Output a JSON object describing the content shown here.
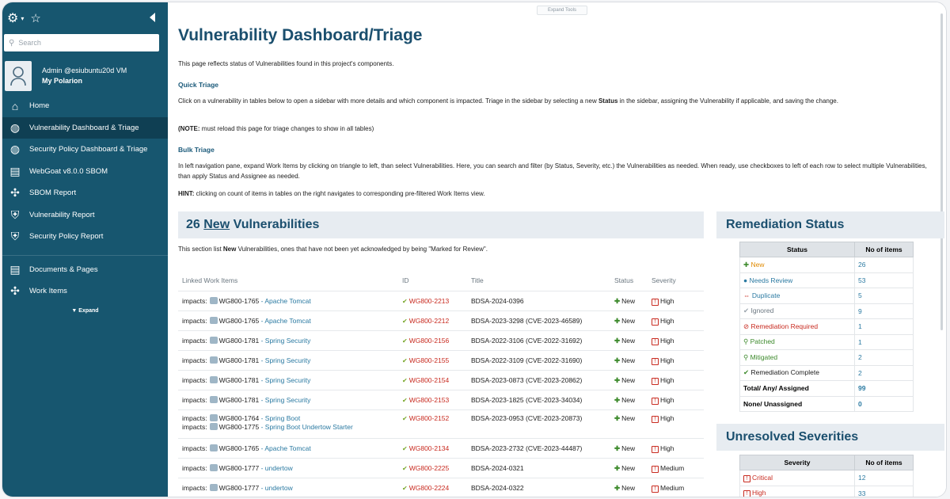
{
  "sidebar": {
    "search_placeholder": "Search",
    "user": {
      "name": "Admin @esiubuntu20d VM",
      "portal": "My Polarion"
    },
    "items": [
      {
        "label": "Home",
        "icon": "home-icon"
      },
      {
        "label": "Vulnerability Dashboard & Triage",
        "icon": "globe-icon",
        "active": true
      },
      {
        "label": "Security Policy Dashboard & Triage",
        "icon": "globe-icon"
      },
      {
        "label": "WebGoat v8.0.0 SBOM",
        "icon": "document-icon"
      },
      {
        "label": "SBOM Report",
        "icon": "puzzle-icon"
      },
      {
        "label": "Vulnerability Report",
        "icon": "shield-icon"
      },
      {
        "label": "Security Policy Report",
        "icon": "shield-icon"
      }
    ],
    "items2": [
      {
        "label": "Documents & Pages",
        "icon": "document-icon"
      },
      {
        "label": "Work Items",
        "icon": "puzzle-icon"
      }
    ],
    "expand_label": "▼ Expand"
  },
  "main": {
    "expand_tools": "Expand Tools",
    "title": "Vulnerability Dashboard/Triage",
    "intro": "This page reflects status of Vulnerabilities found in this project's components.",
    "quick_triage_heading": "Quick Triage",
    "quick_triage_text": "Click on a vulnerability in tables below to open a sidebar with more details and which component is impacted.  Triage in the sidebar by selecting a new ",
    "quick_triage_bold": "Status",
    "quick_triage_text2": " in the sidebar, assigning the Vulnerability if applicable, and saving the change.",
    "note_bold": "(NOTE:",
    "note_text": " must reload this page for triage changes to show in all tables)",
    "bulk_triage_heading": "Bulk Triage",
    "bulk_triage_text": "In left navigation pane, expand Work Items by clicking on triangle to left, than select Vulnerabilities.  Here, you can search and filter (by Status, Severity, etc.) the Vulnerabilities as needed.  When ready, use checkboxes to left of each row to select multiple Vulnerabilities, than apply Status and Assignee as needed.",
    "hint_bold": "HINT:",
    "hint_text": " clicking on count of items in tables on the right navigates to corresponding pre-filtered Work Items view."
  },
  "new_vulns": {
    "count": "26",
    "new_word": "New",
    "rest": "Vulnerabilities",
    "desc_pre": "This section list ",
    "desc_bold": "New",
    "desc_post": " Vulnerabilities, ones that have not been yet acknowledged by being \"Marked for Review\".",
    "columns": [
      "Linked Work Items",
      "ID",
      "Title",
      "Status",
      "Severity"
    ],
    "rows": [
      {
        "links": [
          {
            "pre": "impacts:",
            "wi": "WG800-1765",
            "comp": "- Apache Tomcat"
          }
        ],
        "id": "WG800-2213",
        "title": "BDSA-2024-0396",
        "status": "New",
        "severity": "High"
      },
      {
        "links": [
          {
            "pre": "impacts:",
            "wi": "WG800-1765",
            "comp": "- Apache Tomcat"
          }
        ],
        "id": "WG800-2212",
        "title": "BDSA-2023-3298 (CVE-2023-46589)",
        "status": "New",
        "severity": "High"
      },
      {
        "links": [
          {
            "pre": "impacts:",
            "wi": "WG800-1781",
            "comp": "- Spring Security"
          }
        ],
        "id": "WG800-2156",
        "title": "BDSA-2022-3106 (CVE-2022-31692)",
        "status": "New",
        "severity": "High"
      },
      {
        "links": [
          {
            "pre": "impacts:",
            "wi": "WG800-1781",
            "comp": "- Spring Security"
          }
        ],
        "id": "WG800-2155",
        "title": "BDSA-2022-3109 (CVE-2022-31690)",
        "status": "New",
        "severity": "High"
      },
      {
        "links": [
          {
            "pre": "impacts:",
            "wi": "WG800-1781",
            "comp": "- Spring Security"
          }
        ],
        "id": "WG800-2154",
        "title": "BDSA-2023-0873 (CVE-2023-20862)",
        "status": "New",
        "severity": "High"
      },
      {
        "links": [
          {
            "pre": "impacts:",
            "wi": "WG800-1781",
            "comp": "- Spring Security"
          }
        ],
        "id": "WG800-2153",
        "title": "BDSA-2023-1825 (CVE-2023-34034)",
        "status": "New",
        "severity": "High"
      },
      {
        "links": [
          {
            "pre": "impacts:",
            "wi": "WG800-1764",
            "comp": "- Spring Boot"
          },
          {
            "pre": "impacts:",
            "wi": "WG800-1775",
            "comp": "- Spring Boot Undertow Starter"
          }
        ],
        "id": "WG800-2152",
        "title": "BDSA-2023-0953 (CVE-2023-20873)",
        "status": "New",
        "severity": "High"
      },
      {
        "links": [
          {
            "pre": "impacts:",
            "wi": "WG800-1765",
            "comp": "- Apache Tomcat"
          }
        ],
        "id": "WG800-2134",
        "title": "BDSA-2023-2732 (CVE-2023-44487)",
        "status": "New",
        "severity": "High"
      },
      {
        "links": [
          {
            "pre": "impacts:",
            "wi": "WG800-1777",
            "comp": "- undertow"
          }
        ],
        "id": "WG800-2225",
        "title": "BDSA-2024-0321",
        "status": "New",
        "severity": "Medium"
      },
      {
        "links": [
          {
            "pre": "impacts:",
            "wi": "WG800-1777",
            "comp": "- undertow"
          }
        ],
        "id": "WG800-2224",
        "title": "BDSA-2024-0322",
        "status": "New",
        "severity": "Medium"
      }
    ]
  },
  "remediation": {
    "heading": "Remediation Status",
    "columns": [
      "Status",
      "No of items"
    ],
    "rows": [
      {
        "label": "New",
        "value": "26",
        "color": "#e08a00",
        "icon": "plus-icon",
        "glyph": "✚",
        "icolor": "#3d8a2c"
      },
      {
        "label": "Needs Review",
        "value": "53",
        "color": "#2b7aa2",
        "icon": "review-icon",
        "glyph": "●",
        "icolor": "#2b7aa2"
      },
      {
        "label": "Duplicate",
        "value": "5",
        "color": "#2b7aa2",
        "icon": "duplicate-icon",
        "glyph": "⇔",
        "icolor": "#c82a1f"
      },
      {
        "label": "Ignored",
        "value": "9",
        "color": "#6b7780",
        "icon": "check-icon",
        "glyph": "✔",
        "icolor": "#9aa4ad"
      },
      {
        "label": "Remediation Required",
        "value": "1",
        "color": "#c82a1f",
        "icon": "stop-icon",
        "glyph": "⊘",
        "icolor": "#c82a1f"
      },
      {
        "label": "Patched",
        "value": "1",
        "color": "#3d8a2c",
        "icon": "search-icon",
        "glyph": "⚲",
        "icolor": "#3d8a2c"
      },
      {
        "label": "Mitigated",
        "value": "2",
        "color": "#3d8a2c",
        "icon": "search-icon",
        "glyph": "⚲",
        "icolor": "#3d8a2c"
      },
      {
        "label": "Remediation Complete",
        "value": "2",
        "color": "#1d1d1d",
        "icon": "check-icon",
        "glyph": "✔",
        "icolor": "#3d8a2c"
      }
    ],
    "total_label": "Total/ Any/ Assigned",
    "total_value": "99",
    "none_label": "None/ Unassigned",
    "none_value": "0"
  },
  "unresolved": {
    "heading": "Unresolved Severities",
    "columns": [
      "Severity",
      "No of items"
    ],
    "rows": [
      {
        "label": "Critical",
        "value": "12"
      },
      {
        "label": "High",
        "value": "33"
      }
    ]
  }
}
